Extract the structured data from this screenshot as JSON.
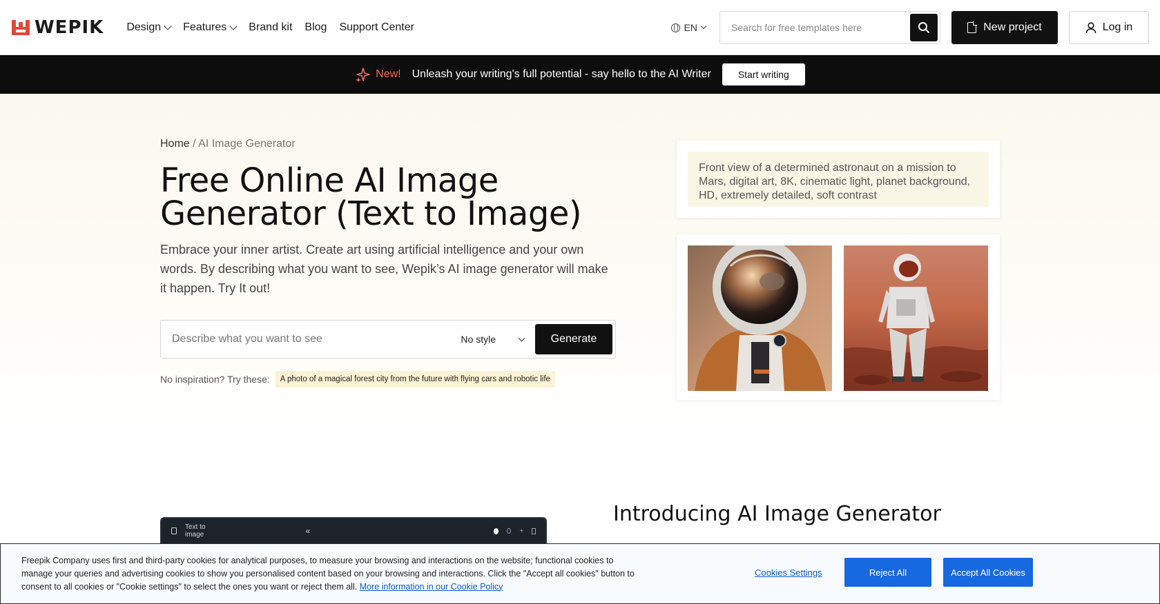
{
  "header": {
    "logo_text": "WEPIK",
    "nav": [
      {
        "label": "Design",
        "dropdown": true
      },
      {
        "label": "Features",
        "dropdown": true
      },
      {
        "label": "Brand kit",
        "dropdown": false
      },
      {
        "label": "Blog",
        "dropdown": false
      },
      {
        "label": "Support Center",
        "dropdown": false
      }
    ],
    "language": "EN",
    "search_placeholder": "Search for free templates here",
    "new_project_label": "New project",
    "login_label": "Log in"
  },
  "promo": {
    "badge": "New!",
    "text": "Unleash your writing's full potential -  say hello to the AI Writer",
    "button": "Start writing"
  },
  "hero": {
    "breadcrumb_home": "Home",
    "breadcrumb_sep": " / ",
    "breadcrumb_current": "AI Image Generator",
    "title": "Free Online AI Image Generator (Text to Image)",
    "description": "Embrace your inner artist. Create art using artificial intelligence and your own words. By describing what you want to see, Wepik’s AI image generator will make it happen. Try It out!",
    "input_placeholder": "Describe what you want to see",
    "style_value": "No style",
    "generate_label": "Generate",
    "inspiration_label": "No inspiration? Try these:",
    "inspiration_chip": "A photo of a magical forest city from the future with flying cars and robotic life",
    "example_prompt": "Front view of a determined astronaut on a mission to Mars, digital art, 8K, cinematic light, planet background, HD, extremely detailed, soft contrast"
  },
  "intro": {
    "title": "Introducing AI Image Generator",
    "preview_panel_title": "Text to image"
  },
  "cookie": {
    "text": "Freepik Company uses first and third-party cookies for analytical purposes, to measure your browsing and interactions on the website; functional cookies to manage your queries and advertising cookies to show you personalised content based on your browsing and interactions. Click the \"Accept all cookies\" button to consent to all cookies or \"Cookie settings\" to select the ones you want or reject them all.",
    "link": "More information in our Cookie Policy",
    "settings_label": "Cookies Settings",
    "reject_label": "Reject All",
    "accept_label": "Accept All Cookies"
  },
  "colors": {
    "brand": "#e0483a",
    "accent_new": "#f36a57",
    "cookie_button": "#1769e0"
  }
}
